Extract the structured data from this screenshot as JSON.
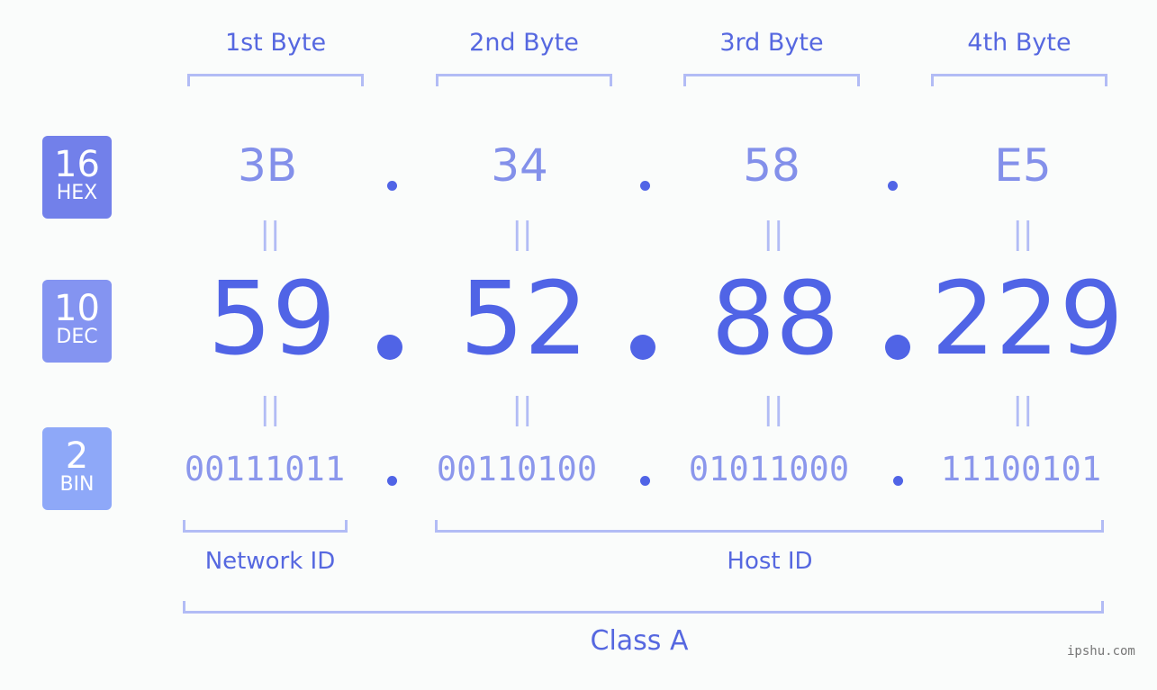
{
  "bases": [
    {
      "num": "16",
      "label": "HEX",
      "color": "#7280ea"
    },
    {
      "num": "10",
      "label": "DEC",
      "color": "#8494f1"
    },
    {
      "num": "2",
      "label": "BIN",
      "color": "#8ea8f8"
    }
  ],
  "bytes": [
    {
      "label": "1st Byte",
      "hex": "3B",
      "dec": "59",
      "bin": "00111011"
    },
    {
      "label": "2nd Byte",
      "hex": "34",
      "dec": "52",
      "bin": "00110100"
    },
    {
      "label": "3rd Byte",
      "hex": "58",
      "dec": "88",
      "bin": "01011000"
    },
    {
      "label": "4th Byte",
      "hex": "E5",
      "dec": "229",
      "bin": "11100101"
    }
  ],
  "equals_symbol": "||",
  "network_id_label": "Network ID",
  "host_id_label": "Host ID",
  "class_label": "Class A",
  "watermark": "ipshu.com"
}
